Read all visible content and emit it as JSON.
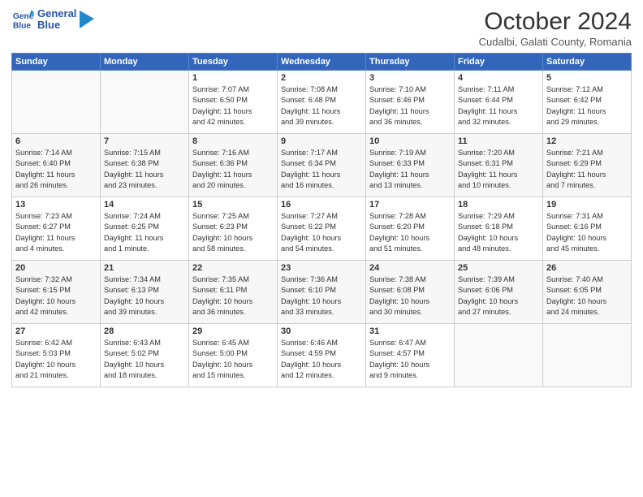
{
  "header": {
    "logo_line1": "General",
    "logo_line2": "Blue",
    "month": "October 2024",
    "location": "Cudalbi, Galati County, Romania"
  },
  "days_of_week": [
    "Sunday",
    "Monday",
    "Tuesday",
    "Wednesday",
    "Thursday",
    "Friday",
    "Saturday"
  ],
  "weeks": [
    [
      {
        "num": "",
        "info": ""
      },
      {
        "num": "",
        "info": ""
      },
      {
        "num": "1",
        "info": "Sunrise: 7:07 AM\nSunset: 6:50 PM\nDaylight: 11 hours\nand 42 minutes."
      },
      {
        "num": "2",
        "info": "Sunrise: 7:08 AM\nSunset: 6:48 PM\nDaylight: 11 hours\nand 39 minutes."
      },
      {
        "num": "3",
        "info": "Sunrise: 7:10 AM\nSunset: 6:46 PM\nDaylight: 11 hours\nand 36 minutes."
      },
      {
        "num": "4",
        "info": "Sunrise: 7:11 AM\nSunset: 6:44 PM\nDaylight: 11 hours\nand 32 minutes."
      },
      {
        "num": "5",
        "info": "Sunrise: 7:12 AM\nSunset: 6:42 PM\nDaylight: 11 hours\nand 29 minutes."
      }
    ],
    [
      {
        "num": "6",
        "info": "Sunrise: 7:14 AM\nSunset: 6:40 PM\nDaylight: 11 hours\nand 26 minutes."
      },
      {
        "num": "7",
        "info": "Sunrise: 7:15 AM\nSunset: 6:38 PM\nDaylight: 11 hours\nand 23 minutes."
      },
      {
        "num": "8",
        "info": "Sunrise: 7:16 AM\nSunset: 6:36 PM\nDaylight: 11 hours\nand 20 minutes."
      },
      {
        "num": "9",
        "info": "Sunrise: 7:17 AM\nSunset: 6:34 PM\nDaylight: 11 hours\nand 16 minutes."
      },
      {
        "num": "10",
        "info": "Sunrise: 7:19 AM\nSunset: 6:33 PM\nDaylight: 11 hours\nand 13 minutes."
      },
      {
        "num": "11",
        "info": "Sunrise: 7:20 AM\nSunset: 6:31 PM\nDaylight: 11 hours\nand 10 minutes."
      },
      {
        "num": "12",
        "info": "Sunrise: 7:21 AM\nSunset: 6:29 PM\nDaylight: 11 hours\nand 7 minutes."
      }
    ],
    [
      {
        "num": "13",
        "info": "Sunrise: 7:23 AM\nSunset: 6:27 PM\nDaylight: 11 hours\nand 4 minutes."
      },
      {
        "num": "14",
        "info": "Sunrise: 7:24 AM\nSunset: 6:25 PM\nDaylight: 11 hours\nand 1 minute."
      },
      {
        "num": "15",
        "info": "Sunrise: 7:25 AM\nSunset: 6:23 PM\nDaylight: 10 hours\nand 58 minutes."
      },
      {
        "num": "16",
        "info": "Sunrise: 7:27 AM\nSunset: 6:22 PM\nDaylight: 10 hours\nand 54 minutes."
      },
      {
        "num": "17",
        "info": "Sunrise: 7:28 AM\nSunset: 6:20 PM\nDaylight: 10 hours\nand 51 minutes."
      },
      {
        "num": "18",
        "info": "Sunrise: 7:29 AM\nSunset: 6:18 PM\nDaylight: 10 hours\nand 48 minutes."
      },
      {
        "num": "19",
        "info": "Sunrise: 7:31 AM\nSunset: 6:16 PM\nDaylight: 10 hours\nand 45 minutes."
      }
    ],
    [
      {
        "num": "20",
        "info": "Sunrise: 7:32 AM\nSunset: 6:15 PM\nDaylight: 10 hours\nand 42 minutes."
      },
      {
        "num": "21",
        "info": "Sunrise: 7:34 AM\nSunset: 6:13 PM\nDaylight: 10 hours\nand 39 minutes."
      },
      {
        "num": "22",
        "info": "Sunrise: 7:35 AM\nSunset: 6:11 PM\nDaylight: 10 hours\nand 36 minutes."
      },
      {
        "num": "23",
        "info": "Sunrise: 7:36 AM\nSunset: 6:10 PM\nDaylight: 10 hours\nand 33 minutes."
      },
      {
        "num": "24",
        "info": "Sunrise: 7:38 AM\nSunset: 6:08 PM\nDaylight: 10 hours\nand 30 minutes."
      },
      {
        "num": "25",
        "info": "Sunrise: 7:39 AM\nSunset: 6:06 PM\nDaylight: 10 hours\nand 27 minutes."
      },
      {
        "num": "26",
        "info": "Sunrise: 7:40 AM\nSunset: 6:05 PM\nDaylight: 10 hours\nand 24 minutes."
      }
    ],
    [
      {
        "num": "27",
        "info": "Sunrise: 6:42 AM\nSunset: 5:03 PM\nDaylight: 10 hours\nand 21 minutes."
      },
      {
        "num": "28",
        "info": "Sunrise: 6:43 AM\nSunset: 5:02 PM\nDaylight: 10 hours\nand 18 minutes."
      },
      {
        "num": "29",
        "info": "Sunrise: 6:45 AM\nSunset: 5:00 PM\nDaylight: 10 hours\nand 15 minutes."
      },
      {
        "num": "30",
        "info": "Sunrise: 6:46 AM\nSunset: 4:59 PM\nDaylight: 10 hours\nand 12 minutes."
      },
      {
        "num": "31",
        "info": "Sunrise: 6:47 AM\nSunset: 4:57 PM\nDaylight: 10 hours\nand 9 minutes."
      },
      {
        "num": "",
        "info": ""
      },
      {
        "num": "",
        "info": ""
      }
    ]
  ]
}
